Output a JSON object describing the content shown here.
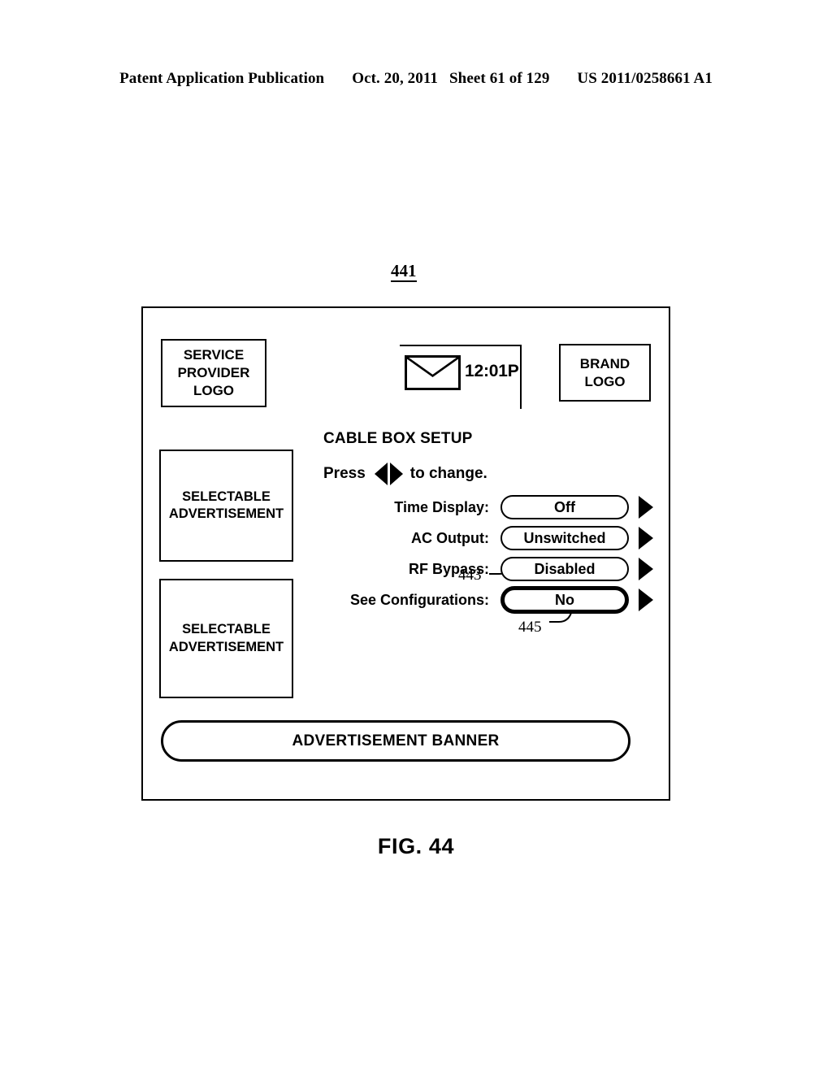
{
  "page_header": {
    "publication": "Patent Application Publication",
    "date": "Oct. 20, 2011",
    "sheet": "Sheet 61 of 129",
    "patent_number": "US 2011/0258661 A1"
  },
  "figure": {
    "reference_numeral": "441",
    "caption": "FIG. 44"
  },
  "screen": {
    "service_provider_logo": "SERVICE PROVIDER LOGO",
    "brand_logo": "BRAND LOGO",
    "status_bar": {
      "mail_icon": "envelope-icon",
      "time": "12:01P"
    },
    "ads": [
      {
        "label": "SELECTABLE ADVERTISEMENT"
      },
      {
        "label": "SELECTABLE ADVERTISEMENT"
      }
    ],
    "setup_panel": {
      "title": "CABLE BOX SETUP",
      "instruction_prefix": "Press",
      "instruction_suffix": "to change.",
      "left_arrow_icon": "triangle-left-icon",
      "right_arrow_icon": "triangle-right-icon",
      "rows": [
        {
          "label": "Time Display:",
          "value": "Off",
          "arrow_icon": "triangle-right-icon",
          "highlighted": false
        },
        {
          "label": "AC Output:",
          "value": "Unswitched",
          "arrow_icon": "triangle-right-icon",
          "highlighted": false
        },
        {
          "label": "RF Bypass:",
          "value": "Disabled",
          "arrow_icon": "triangle-right-icon",
          "highlighted": false
        },
        {
          "label": "See Configurations:",
          "value": "No",
          "arrow_icon": "triangle-right-icon",
          "highlighted": true
        }
      ]
    },
    "callouts": [
      {
        "numeral": "443"
      },
      {
        "numeral": "445"
      }
    ],
    "ad_banner": "ADVERTISEMENT BANNER"
  },
  "colors": {
    "ink": "#000000",
    "paper": "#ffffff"
  }
}
